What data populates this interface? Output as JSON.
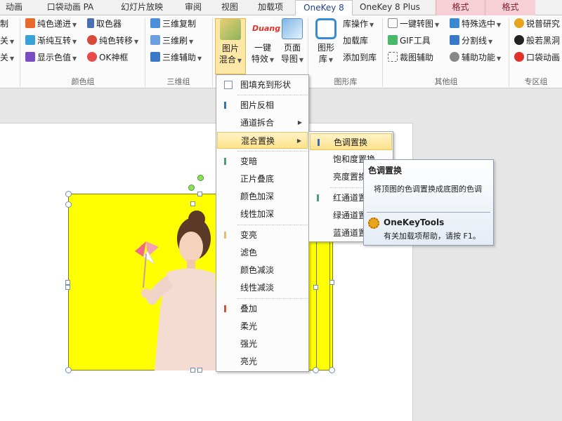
{
  "tabs": [
    {
      "label": "动画"
    },
    {
      "label": "口袋动画 PA"
    },
    {
      "label": "幻灯片放映"
    },
    {
      "label": "审阅"
    },
    {
      "label": "视图"
    },
    {
      "label": "加载项"
    },
    {
      "label": "OneKey 8"
    },
    {
      "label": "OneKey 8 Plus"
    },
    {
      "label": "格式"
    },
    {
      "label": "格式"
    }
  ],
  "ribbon": {
    "left_col1": [
      "制",
      "关",
      "关"
    ],
    "color_group": {
      "items": [
        "纯色递进",
        "取色器",
        "渐纯互转",
        "纯色转移",
        "显示色值",
        "OK神框"
      ],
      "label": "颜色组"
    },
    "threed_group": {
      "items": [
        "三维复制",
        "三维刷",
        "三维辅助"
      ],
      "label": "三维组"
    },
    "big_buttons": {
      "picture_blend": [
        "图片",
        "混合"
      ],
      "oneclick_effect": [
        "一键",
        "特效"
      ],
      "page_guide": [
        "页面",
        "导图"
      ],
      "shape_lib": [
        "图形",
        "库"
      ],
      "duang": "Duang"
    },
    "lib_group": {
      "items": [
        "库操作",
        "加载库",
        "添加到库"
      ],
      "label": "图形库"
    },
    "other_group": {
      "items": [
        "一键转图",
        "特殊选中",
        "GIF工具",
        "分割线",
        "裁图辅助",
        "辅助功能"
      ],
      "label": "其他组"
    },
    "special_group": {
      "items": [
        "锐普研究",
        "般若黑洞",
        "口袋动画"
      ],
      "label": "专区组"
    }
  },
  "menu": {
    "items": [
      "图填充到形状",
      "图片反相",
      "通道拆合",
      "混合置换",
      "变暗",
      "正片叠底",
      "颜色加深",
      "线性加深",
      "变亮",
      "滤色",
      "颜色减淡",
      "线性减淡",
      "叠加",
      "柔光",
      "强光",
      "亮光"
    ]
  },
  "submenu": {
    "items": [
      "色调置换",
      "饱和度置换",
      "亮度置换",
      "红通道置换",
      "绿通道置换",
      "蓝通道置换"
    ]
  },
  "tooltip": {
    "title": "色调置换",
    "desc": "将顶图的色调置换成底图的色调",
    "tool_name": "OneKeyTools",
    "help": "有关加载项帮助，请按 F1。"
  },
  "colors": {
    "accent": "#4a6fb3",
    "highlight": "#fde28a",
    "shape_fill": "#ffff00"
  }
}
